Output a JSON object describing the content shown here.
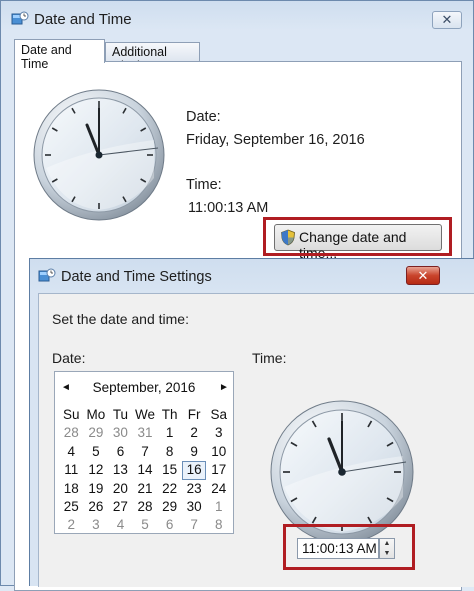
{
  "outer_window": {
    "title": "Date and Time",
    "close_label": "✕",
    "tabs": [
      {
        "label": "Date and Time",
        "active": true
      },
      {
        "label": "Additional Clocks",
        "active": false
      }
    ],
    "date_label": "Date:",
    "date_value": "Friday, September 16, 2016",
    "time_label": "Time:",
    "time_value": "11:00:13 AM",
    "change_button_label": "Change date and time..."
  },
  "dialog": {
    "title": "Date and Time Settings",
    "close_label": "✕",
    "instruction": "Set the date and time:",
    "date_label": "Date:",
    "time_label": "Time:",
    "calendar": {
      "prev_label": "◄",
      "next_label": "►",
      "month_label": "September, 2016",
      "weekdays": [
        "Su",
        "Mo",
        "Tu",
        "We",
        "Th",
        "Fr",
        "Sa"
      ],
      "weeks": [
        [
          "28",
          "29",
          "30",
          "31",
          "1",
          "2",
          "3"
        ],
        [
          "4",
          "5",
          "6",
          "7",
          "8",
          "9",
          "10"
        ],
        [
          "11",
          "12",
          "13",
          "14",
          "15",
          "16",
          "17"
        ],
        [
          "18",
          "19",
          "20",
          "21",
          "22",
          "23",
          "24"
        ],
        [
          "25",
          "26",
          "27",
          "28",
          "29",
          "30",
          "1"
        ],
        [
          "2",
          "3",
          "4",
          "5",
          "6",
          "7",
          "8"
        ]
      ],
      "selected_day": "16"
    },
    "time_value": "11:00:13 AM",
    "spin_up": "▲",
    "spin_down": "▼"
  },
  "colors": {
    "highlight": "#b01d22",
    "title_bar": "#cfdeef",
    "close_red": "#c9442c"
  },
  "icons": {
    "app": "date-time-app-icon",
    "shield": "uac-shield-icon",
    "close": "close-icon",
    "clock": "analog-clock"
  }
}
